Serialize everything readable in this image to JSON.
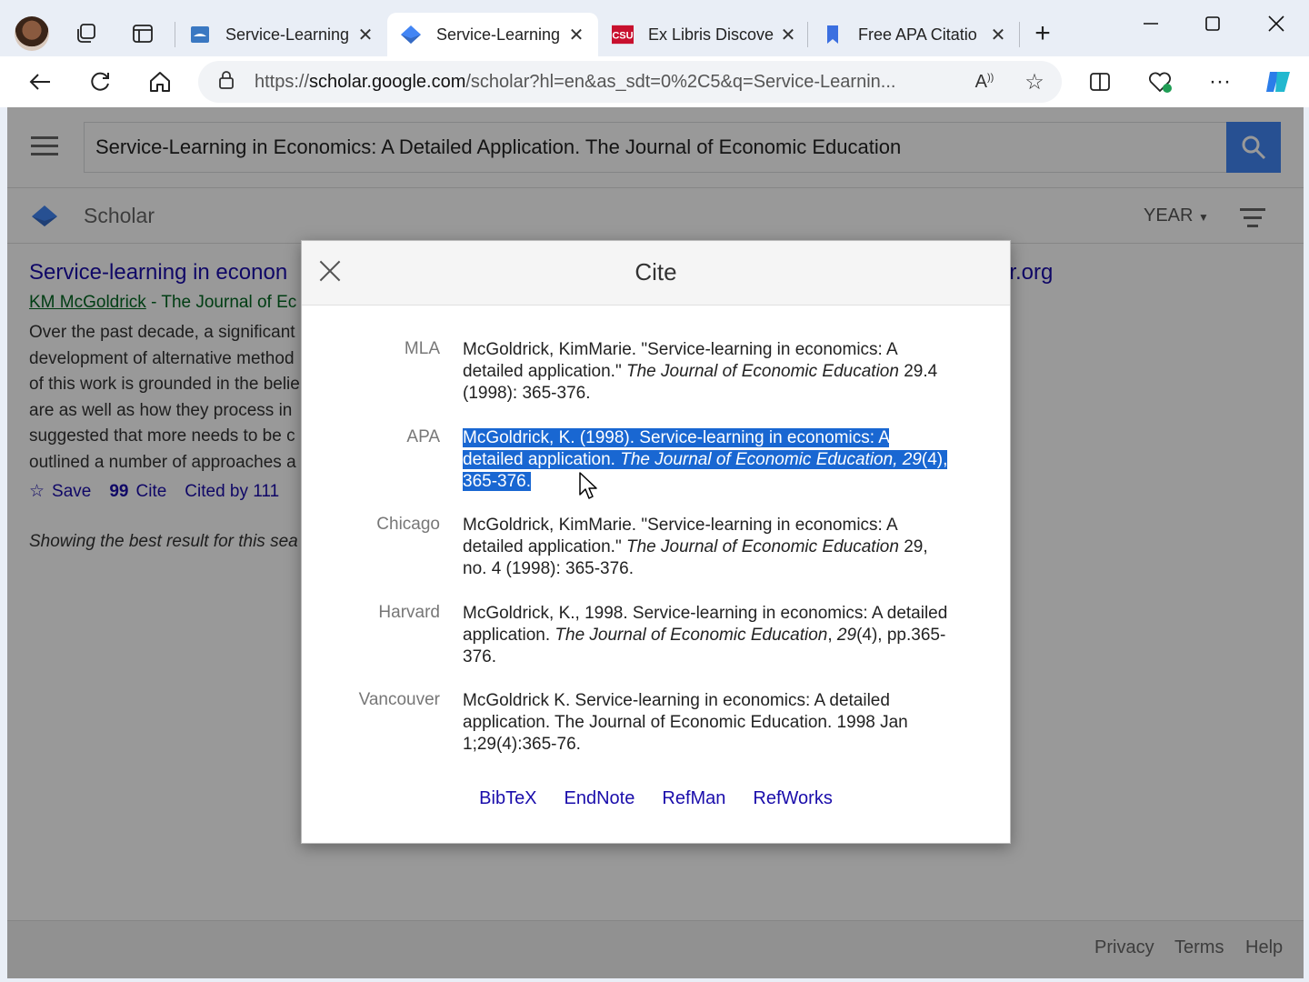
{
  "browser": {
    "tabs": [
      {
        "title": "Service-Learning",
        "favicon": "book-icon",
        "active": false
      },
      {
        "title": "Service-Learning",
        "favicon": "scholar-cap-icon",
        "active": true
      },
      {
        "title": "Ex Libris Discove",
        "favicon": "csu-logo",
        "active": false
      },
      {
        "title": "Free APA Citatio",
        "favicon": "bookmark-icon",
        "active": false
      }
    ],
    "address": {
      "scheme": "https://",
      "host": "scholar.google.com",
      "path": "/scholar?hl=en&as_sdt=0%2C5&q=Service-Learnin..."
    }
  },
  "scholar": {
    "search_query": "Service-Learning in Economics: A Detailed Application. The Journal of Economic Education",
    "brand": "Scholar",
    "year_filter": "YEAR",
    "result": {
      "title_visible": "Service-learning in econon",
      "title_tail": "or.org",
      "author_link": "KM McGoldrick",
      "author_rest": "- The Journal of Ec",
      "snippet_lines": [
        "Over the past decade, a significant",
        "development of alternative method",
        "of this work is grounded in the belie",
        "are as well as how they process in",
        "suggested that more needs to be c",
        "outlined a number of approaches a"
      ],
      "save_label": "Save",
      "cite_label": "Cite",
      "cited_by": "Cited by 111"
    },
    "showing_text": "Showing the best result for this sea",
    "footer": {
      "privacy": "Privacy",
      "terms": "Terms",
      "help": "Help"
    }
  },
  "cite_dialog": {
    "title": "Cite",
    "styles": [
      {
        "label": "MLA",
        "pre": "McGoldrick, KimMarie. \"Service-learning in economics: A detailed application.\" ",
        "journal": "The Journal of Economic Education",
        "post": " 29.4 (1998): 365-376."
      },
      {
        "label": "APA",
        "pre": "McGoldrick, K. (1998). Service-learning in economics: A detailed application. ",
        "journal": "The Journal of Economic Education, 29",
        "post": "(4), 365-376."
      },
      {
        "label": "Chicago",
        "pre": "McGoldrick, KimMarie. \"Service-learning in economics: A detailed application.\" ",
        "journal": "The Journal of Economic Education",
        "post": " 29, no. 4 (1998): 365-376."
      },
      {
        "label": "Harvard",
        "pre": "McGoldrick, K., 1998. Service-learning in economics: A detailed application. ",
        "journal": "The Journal of Economic Education",
        "mid": ", ",
        "journal2": "29",
        "post": "(4), pp.365-376."
      },
      {
        "label": "Vancouver",
        "pre": "McGoldrick K. Service-learning in economics: A detailed application. The Journal of Economic Education. 1998 Jan 1;29(4):365-76.",
        "journal": "",
        "post": ""
      }
    ],
    "export_links": [
      "BibTeX",
      "EndNote",
      "RefMan",
      "RefWorks"
    ]
  },
  "colors": {
    "accent": "#4285f4",
    "selection": "#1967d2",
    "link": "#1a0dab",
    "author_green": "#006621"
  }
}
